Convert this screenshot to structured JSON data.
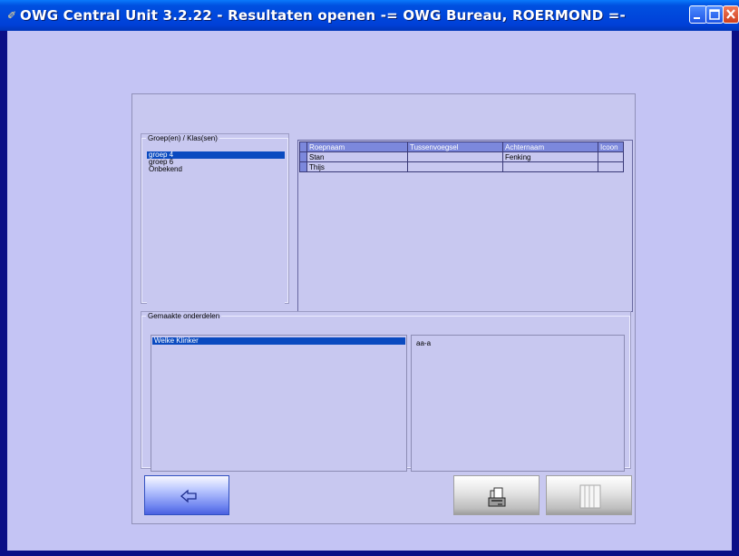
{
  "window": {
    "title": "OWG Central Unit 3.2.22 - Resultaten openen  -= OWG Bureau, ROERMOND =-",
    "app_icon": "app-icon",
    "controls": [
      "minimize-icon",
      "maximize-icon",
      "close-icon"
    ]
  },
  "groups": {
    "legend": "Groep(en) / Klas(sen)",
    "items": [
      {
        "label": "groep 4",
        "selected": true
      },
      {
        "label": "groep 6",
        "selected": false
      },
      {
        "label": "Onbekend",
        "selected": false
      }
    ]
  },
  "students": {
    "columns": [
      "Roepnaam",
      "Tussenvoegsel",
      "Achternaam",
      "Icoon"
    ],
    "rows": [
      [
        "Stan",
        "",
        "Fenking",
        ""
      ],
      [
        "Thijs",
        "",
        "",
        ""
      ]
    ]
  },
  "parts": {
    "legend": "Gemaakte onderdelen",
    "items": [
      {
        "label": "Welke Klinker",
        "selected": true
      }
    ],
    "detail": "aa-a"
  },
  "buttons": {
    "back_icon": "arrow-left-icon",
    "print_icon": "printer-icon",
    "columns_icon": "columns-icon"
  },
  "colors": {
    "titlebar": "#0050e0",
    "window_bg": "#c4c4f4",
    "selection": "#0a4ac0",
    "grid_header": "#7c88dc"
  }
}
